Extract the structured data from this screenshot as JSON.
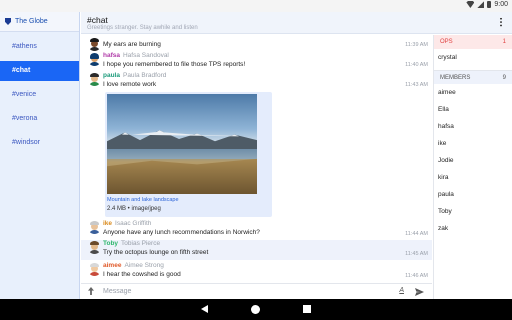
{
  "status_bar": {
    "time": "9:00"
  },
  "sidebar": {
    "server_name": "The Globe",
    "channels": [
      {
        "label": "#athens",
        "active": false
      },
      {
        "label": "#chat",
        "active": true
      },
      {
        "label": "#venice",
        "active": false
      },
      {
        "label": "#verona",
        "active": false
      },
      {
        "label": "#windsor",
        "active": false
      }
    ]
  },
  "header": {
    "title": "#chat",
    "topic": "Greetings stranger. Stay awhile and listen"
  },
  "messages": [
    {
      "nick": "",
      "realname": "",
      "text": "My ears are burning",
      "time": "11:39 AM",
      "avatar": "burning-ears-avatar"
    },
    {
      "nick": "hafsa",
      "realname": "Hafsa Sandoval",
      "text": "I hope you remembered to file those TPS reports!",
      "time": "11:40 AM",
      "nick_color": "#b03aa8",
      "avatar": "hafsa-avatar"
    },
    {
      "nick": "paula",
      "realname": "Paula Bradford",
      "text": "I love remote work",
      "time": "11:43 AM",
      "nick_color": "#1a9a7a",
      "avatar": "paula-avatar"
    },
    {
      "nick": "ike",
      "realname": "Isaac Griffith",
      "text": "Anyone have any lunch recommendations in Norwich?",
      "time": "11:44 AM",
      "nick_color": "#d98a1c",
      "avatar": "ike-avatar"
    },
    {
      "nick": "Toby",
      "realname": "Tobias Pierce",
      "text": "Try the octopus lounge on fifth street",
      "time": "11:45 AM",
      "nick_color": "#2bb56a",
      "avatar": "toby-avatar"
    },
    {
      "nick": "aimee",
      "realname": "Aimee Strong",
      "text": "I hear the cowshed is good",
      "time": "11:46 AM",
      "nick_color": "#e05a2a",
      "avatar": "aimee-avatar"
    }
  ],
  "attachment": {
    "caption": "Mountain and lake landscape",
    "info": "2.4 MB • image/jpeg"
  },
  "input": {
    "placeholder": "Message"
  },
  "userlist": {
    "ops_label": "OPS",
    "ops_count": "1",
    "ops": [
      "crystal"
    ],
    "members_label": "MEMBERS",
    "members_count": "9",
    "members": [
      "aimee",
      "Ella",
      "hafsa",
      "ike",
      "Jodie",
      "kira",
      "paula",
      "Toby",
      "zak"
    ]
  }
}
